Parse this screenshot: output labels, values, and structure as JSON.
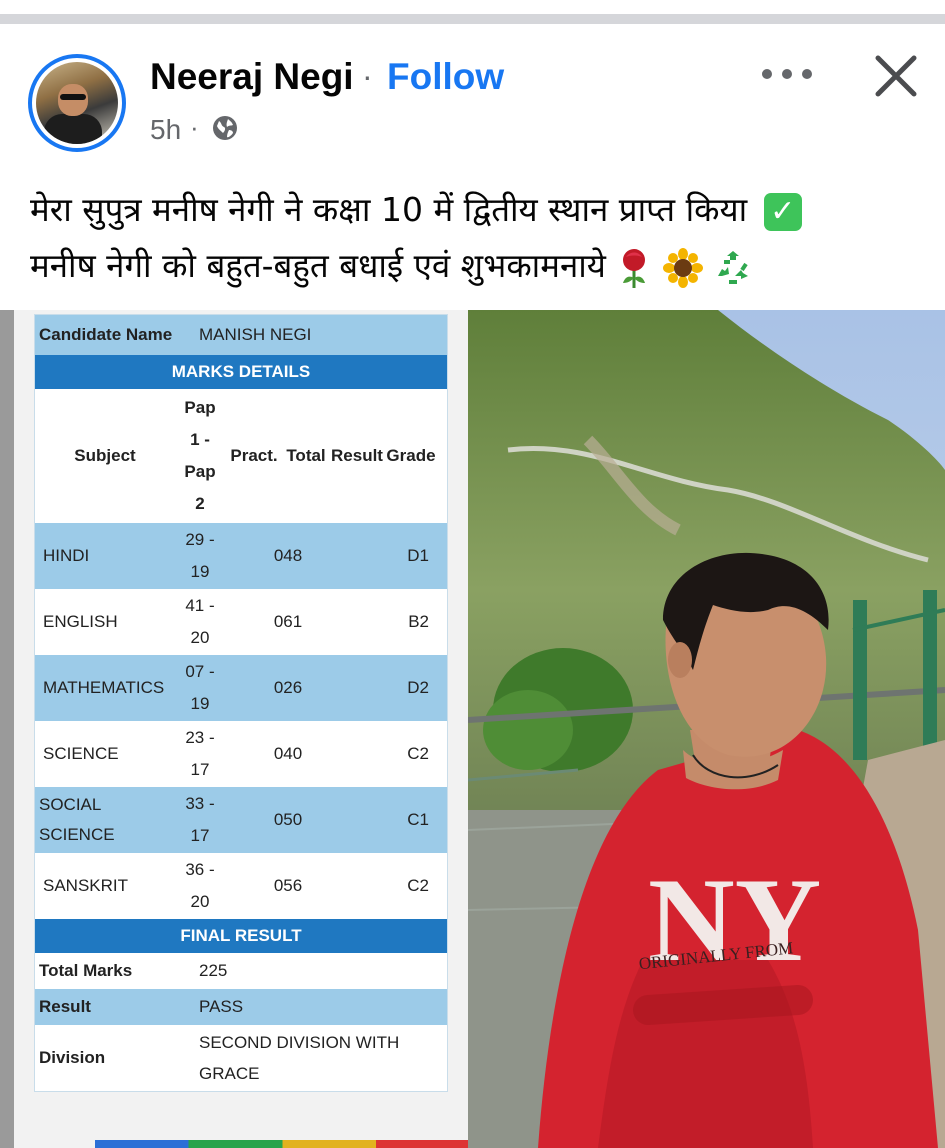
{
  "post": {
    "author": "Neeraj Negi",
    "separator": "·",
    "follow_label": "Follow",
    "time": "5h",
    "time_separator": "·",
    "caption_line1": "मेरा सुपुत्र मनीष नेगी ने कक्षा 10 में द्वितीय स्थान प्राप्त किया",
    "caption_line2": "मनीष नेगी को बहुत-बहुत बधाई एवं शुभकामनाये"
  },
  "result_card": {
    "candidate_label": "Candidate Name",
    "candidate_value": "MANISH NEGI",
    "marks_title": "MARKS DETAILS",
    "headers": {
      "subject": "Subject",
      "pap_lines": [
        "Pap",
        "1 -",
        "Pap",
        "2"
      ],
      "pract": "Pract.",
      "total": "Total",
      "result": "Result",
      "grade": "Grade"
    },
    "rows": [
      {
        "subject_lines": [
          "HINDI"
        ],
        "pap_lines": [
          "29 -",
          "19"
        ],
        "total": "048",
        "grade": "D1"
      },
      {
        "subject_lines": [
          "ENGLISH"
        ],
        "pap_lines": [
          "41 -",
          "20"
        ],
        "total": "061",
        "grade": "B2"
      },
      {
        "subject_lines": [
          "MATHEMATICS"
        ],
        "pap_lines": [
          "07 -",
          "19"
        ],
        "total": "026",
        "grade": "D2"
      },
      {
        "subject_lines": [
          "SCIENCE"
        ],
        "pap_lines": [
          "23 -",
          "17"
        ],
        "total": "040",
        "grade": "C2"
      },
      {
        "subject_lines": [
          "SOCIAL",
          "SCIENCE"
        ],
        "pap_lines": [
          "33 -",
          "17"
        ],
        "total": "050",
        "grade": "C1"
      },
      {
        "subject_lines": [
          "SANSKRIT"
        ],
        "pap_lines": [
          "36 -",
          "20"
        ],
        "total": "056",
        "grade": "C2"
      }
    ],
    "final_title": "FINAL RESULT",
    "total_marks_label": "Total Marks",
    "total_marks_value": "225",
    "result_label": "Result",
    "result_value": "PASS",
    "division_label": "Division",
    "division_lines": [
      "SECOND DIVISION WITH",
      "GRACE"
    ]
  },
  "photo": {
    "shirt_text_main": "NY",
    "shirt_text_small": "ORIGINALLY FROM"
  },
  "icons": [
    "globe-icon",
    "more-options-icon",
    "close-icon",
    "check-mark-emoji",
    "rose-emoji",
    "sunflower-emoji",
    "recycle-emoji"
  ],
  "colors": {
    "brand_blue": "#1877f2",
    "table_header_blue": "#1f78c1",
    "table_row_blue": "#9ccbe8",
    "sweater_red": "#d4232f"
  }
}
